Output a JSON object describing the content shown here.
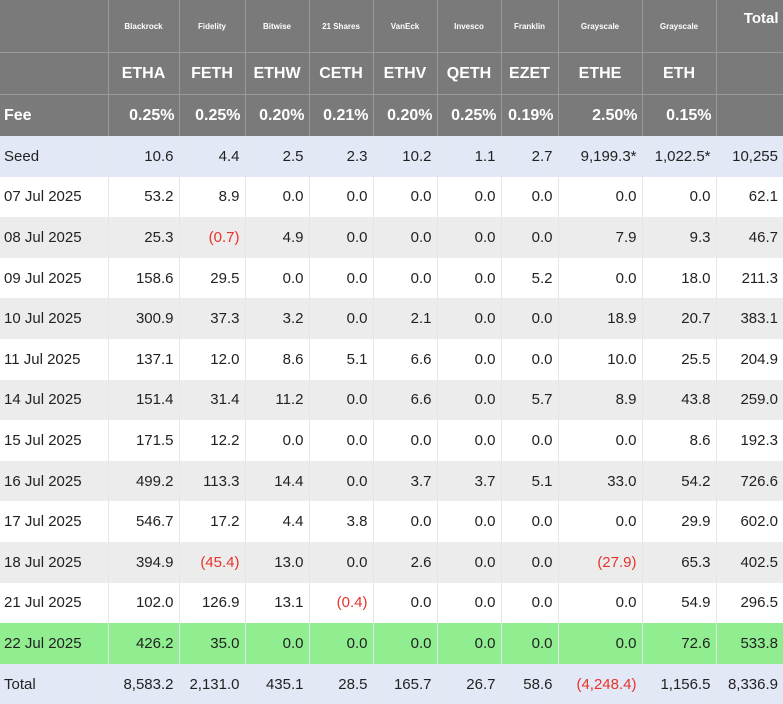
{
  "issuers": [
    "Blackrock",
    "Fidelity",
    "Bitwise",
    "21 Shares",
    "VanEck",
    "Invesco",
    "Franklin",
    "Grayscale",
    "Grayscale"
  ],
  "total_header": "Total",
  "tickers": [
    "ETHA",
    "FETH",
    "ETHW",
    "CETH",
    "ETHV",
    "QETH",
    "EZET",
    "ETHE",
    "ETH"
  ],
  "fee_label": "Fee",
  "fees": [
    "0.25%",
    "0.25%",
    "0.20%",
    "0.21%",
    "0.20%",
    "0.25%",
    "0.19%",
    "2.50%",
    "0.15%"
  ],
  "seed": {
    "label": "Seed",
    "values": [
      "10.6",
      "4.4",
      "2.5",
      "2.3",
      "10.2",
      "1.1",
      "2.7",
      "9,199.3*",
      "1,022.5*",
      "10,255"
    ]
  },
  "rows": [
    {
      "date": "07 Jul 2025",
      "values": [
        "53.2",
        "8.9",
        "0.0",
        "0.0",
        "0.0",
        "0.0",
        "0.0",
        "0.0",
        "0.0",
        "62.1"
      ]
    },
    {
      "date": "08 Jul 2025",
      "values": [
        "25.3",
        "(0.7)",
        "4.9",
        "0.0",
        "0.0",
        "0.0",
        "0.0",
        "7.9",
        "9.3",
        "46.7"
      ]
    },
    {
      "date": "09 Jul 2025",
      "values": [
        "158.6",
        "29.5",
        "0.0",
        "0.0",
        "0.0",
        "0.0",
        "5.2",
        "0.0",
        "18.0",
        "211.3"
      ]
    },
    {
      "date": "10 Jul 2025",
      "values": [
        "300.9",
        "37.3",
        "3.2",
        "0.0",
        "2.1",
        "0.0",
        "0.0",
        "18.9",
        "20.7",
        "383.1"
      ]
    },
    {
      "date": "11 Jul 2025",
      "values": [
        "137.1",
        "12.0",
        "8.6",
        "5.1",
        "6.6",
        "0.0",
        "0.0",
        "10.0",
        "25.5",
        "204.9"
      ]
    },
    {
      "date": "14 Jul 2025",
      "values": [
        "151.4",
        "31.4",
        "11.2",
        "0.0",
        "6.6",
        "0.0",
        "5.7",
        "8.9",
        "43.8",
        "259.0"
      ]
    },
    {
      "date": "15 Jul 2025",
      "values": [
        "171.5",
        "12.2",
        "0.0",
        "0.0",
        "0.0",
        "0.0",
        "0.0",
        "0.0",
        "8.6",
        "192.3"
      ]
    },
    {
      "date": "16 Jul 2025",
      "values": [
        "499.2",
        "113.3",
        "14.4",
        "0.0",
        "3.7",
        "3.7",
        "5.1",
        "33.0",
        "54.2",
        "726.6"
      ]
    },
    {
      "date": "17 Jul 2025",
      "values": [
        "546.7",
        "17.2",
        "4.4",
        "3.8",
        "0.0",
        "0.0",
        "0.0",
        "0.0",
        "29.9",
        "602.0"
      ]
    },
    {
      "date": "18 Jul 2025",
      "values": [
        "394.9",
        "(45.4)",
        "13.0",
        "0.0",
        "2.6",
        "0.0",
        "0.0",
        "(27.9)",
        "65.3",
        "402.5"
      ]
    },
    {
      "date": "21 Jul 2025",
      "values": [
        "102.0",
        "126.9",
        "13.1",
        "(0.4)",
        "0.0",
        "0.0",
        "0.0",
        "0.0",
        "54.9",
        "296.5"
      ]
    },
    {
      "date": "22 Jul 2025",
      "values": [
        "426.2",
        "35.0",
        "0.0",
        "0.0",
        "0.0",
        "0.0",
        "0.0",
        "0.0",
        "72.6",
        "533.8"
      ]
    }
  ],
  "totals": {
    "label": "Total",
    "values": [
      "8,583.2",
      "2,131.0",
      "435.1",
      "28.5",
      "165.7",
      "26.7",
      "58.6",
      "(4,248.4)",
      "1,156.5",
      "8,336.9"
    ]
  },
  "colors": {
    "header_bg": "#7a7a7a",
    "seed_total_bg": "#e2e8f5",
    "alt_row_bg": "#ececec",
    "latest_row_bg": "#90ee90",
    "negative": "#e8332a"
  }
}
